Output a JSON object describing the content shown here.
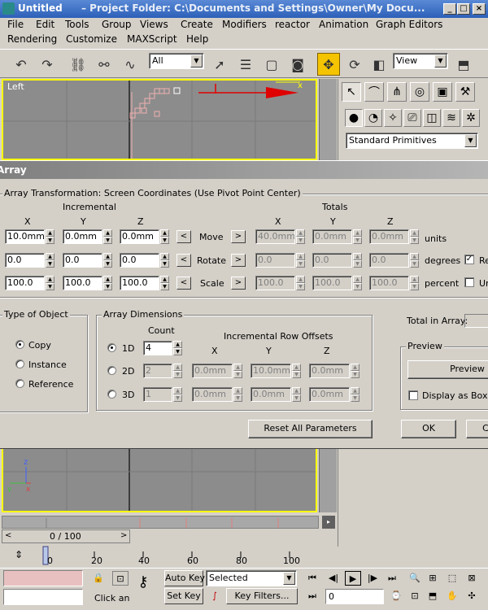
{
  "app": {
    "title_file": "Untitled",
    "title_rest": "– Project Folder: C:\\Documents and Settings\\Owner\\My Docu...",
    "menu1": [
      "File",
      "Edit",
      "Tools",
      "Group",
      "Views",
      "Create",
      "Modifiers",
      "reactor",
      "Animation",
      "Graph Editors"
    ],
    "menu2": [
      "Rendering",
      "Customize",
      "MAXScript",
      "Help"
    ],
    "selection_filter": "All",
    "ref_coord": "View",
    "viewport_label": "Left",
    "cmd_dropdown": "Standard Primitives",
    "colors": {
      "viewport_border": "#ffff00",
      "accent": "#f5c400",
      "arrow": "#e00000"
    }
  },
  "dialog": {
    "title": "Array",
    "transform_title": "Array Transformation: Screen Coordinates (Use Pivot Point Center)",
    "incremental": "Incremental",
    "totals": "Totals",
    "axes": [
      "X",
      "Y",
      "Z"
    ],
    "rows": [
      {
        "label": "Move",
        "inc": [
          "10.0mm",
          "0.0mm",
          "0.0mm"
        ],
        "tot": [
          "40.0mm",
          "0.0mm",
          "0.0mm"
        ],
        "unit": "units"
      },
      {
        "label": "Rotate",
        "inc": [
          "0.0",
          "0.0",
          "0.0"
        ],
        "tot": [
          "0.0",
          "0.0",
          "0.0"
        ],
        "unit": "degrees"
      },
      {
        "label": "Scale",
        "inc": [
          "100.0",
          "100.0",
          "100.0"
        ],
        "tot": [
          "100.0",
          "100.0",
          "100.0"
        ],
        "unit": "percent"
      }
    ],
    "re_orient": "Re",
    "uniform": "Ur",
    "left_arrow": "<",
    "right_arrow": ">",
    "type_title": "Type of Object",
    "types": [
      "Copy",
      "Instance",
      "Reference"
    ],
    "dims_title": "Array Dimensions",
    "count_label": "Count",
    "offsets_label": "Incremental Row Offsets",
    "dims": [
      {
        "label": "1D",
        "count": "4",
        "offsets": null
      },
      {
        "label": "2D",
        "count": "2",
        "offsets": [
          "0.0mm",
          "10.0mm",
          "0.0mm"
        ]
      },
      {
        "label": "3D",
        "count": "1",
        "offsets": [
          "0.0mm",
          "0.0mm",
          "0.0mm"
        ]
      }
    ],
    "total_in_array": "Total in Array:",
    "preview_title": "Preview",
    "preview_btn": "Preview",
    "display_as_box": "Display as Box",
    "reset_btn": "Reset All Parameters",
    "ok_btn": "OK",
    "cancel_btn": "C"
  },
  "timeline": {
    "frame_display": "0 / 100",
    "prev": "<",
    "next": ">",
    "ticks": [
      "0",
      "20",
      "40",
      "60",
      "80",
      "100"
    ]
  },
  "status": {
    "auto_key": "Auto Key",
    "set_key": "Set Key",
    "key_mode": "Selected",
    "key_filters": "Key Filters...",
    "click_hint": "Click an",
    "frame": "0"
  }
}
